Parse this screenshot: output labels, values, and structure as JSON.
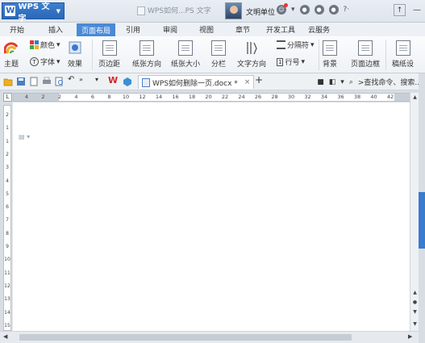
{
  "titlebar": {
    "app_name": "WPS 文字",
    "logo_letter": "W",
    "inactive_tab": "WPS如何...PS 文字",
    "user_name": "文明单位"
  },
  "menu": {
    "tabs": [
      {
        "label": "开始"
      },
      {
        "label": "插入"
      },
      {
        "label": "页面布局",
        "active": true
      },
      {
        "label": "引用"
      },
      {
        "label": "审阅"
      },
      {
        "label": "视图"
      },
      {
        "label": "章节"
      },
      {
        "label": "开发工具"
      },
      {
        "label": "云服务"
      }
    ]
  },
  "ribbon": {
    "theme": "主题",
    "colors": "颜色",
    "font": "字体",
    "effects": "效果",
    "margins": "页边距",
    "orientation": "纸张方向",
    "size": "纸张大小",
    "columns": "分栏",
    "text_direction": "文字方向",
    "breaks": "分隔符",
    "line_numbers": "行号",
    "background": "背景",
    "page_border": "页面边框",
    "manuscript": "稿纸设"
  },
  "qat": {
    "doc_tab": "WPS如何删除一页.docx *",
    "search": ">查找命令、搜索..."
  },
  "ruler": {
    "h_numbers": [
      "4",
      "2",
      "2",
      "4",
      "6",
      "8",
      "10",
      "12",
      "14",
      "16",
      "18",
      "20",
      "22",
      "24",
      "26",
      "28",
      "30",
      "32",
      "34",
      "36",
      "38",
      "40",
      "42"
    ],
    "v_numbers": [
      "2",
      "1",
      "1",
      "2",
      "3",
      "4",
      "5",
      "6",
      "7",
      "8",
      "9",
      "10",
      "11",
      "12",
      "13",
      "14",
      "15"
    ],
    "corner": "L"
  },
  "colors": {
    "accent": "#4a8ad6",
    "app_button": "#2b68b8",
    "side_handle": "#3a7bd0"
  }
}
